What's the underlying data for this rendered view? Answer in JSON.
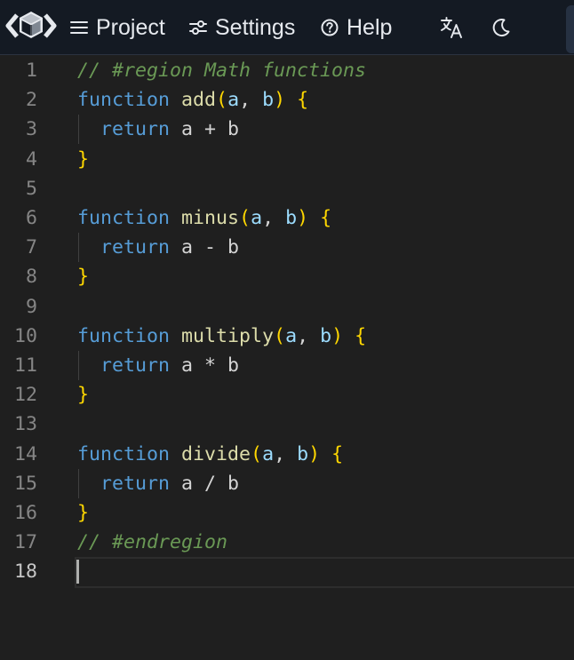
{
  "nav": {
    "project_label": "Project",
    "settings_label": "Settings",
    "help_label": "Help"
  },
  "icons": {
    "logo": "cube-logo-icon",
    "project": "hamburger-menu-icon",
    "settings": "sliders-icon",
    "help": "question-circle-icon",
    "translate": "translate-icon",
    "theme": "moon-icon"
  },
  "colors": {
    "topbar_bg": "#141a23",
    "editor_bg": "#1f1f1f",
    "keyword": "#569cd6",
    "function_name": "#dcdcaa",
    "param": "#9cdcfe",
    "brace": "#ffd700",
    "comment": "#6a9955"
  },
  "editor": {
    "current_line": 18,
    "lines": [
      {
        "num": "1",
        "tokens": [
          {
            "t": "// #region Math functions",
            "c": "comment"
          }
        ]
      },
      {
        "num": "2",
        "tokens": [
          {
            "t": "function",
            "c": "keyword"
          },
          {
            "t": " ",
            "c": "plain"
          },
          {
            "t": "add",
            "c": "func"
          },
          {
            "t": "(",
            "c": "brace"
          },
          {
            "t": "a",
            "c": "param"
          },
          {
            "t": ", ",
            "c": "plain"
          },
          {
            "t": "b",
            "c": "param"
          },
          {
            "t": ")",
            "c": "brace"
          },
          {
            "t": " ",
            "c": "plain"
          },
          {
            "t": "{",
            "c": "brace"
          }
        ]
      },
      {
        "num": "3",
        "tokens": [
          {
            "t": "  ",
            "c": "plain"
          },
          {
            "t": "return",
            "c": "keyword"
          },
          {
            "t": " a + b",
            "c": "plain"
          }
        ],
        "guide": true
      },
      {
        "num": "4",
        "tokens": [
          {
            "t": "}",
            "c": "brace"
          }
        ]
      },
      {
        "num": "5",
        "tokens": []
      },
      {
        "num": "6",
        "tokens": [
          {
            "t": "function",
            "c": "keyword"
          },
          {
            "t": " ",
            "c": "plain"
          },
          {
            "t": "minus",
            "c": "func"
          },
          {
            "t": "(",
            "c": "brace"
          },
          {
            "t": "a",
            "c": "param"
          },
          {
            "t": ", ",
            "c": "plain"
          },
          {
            "t": "b",
            "c": "param"
          },
          {
            "t": ")",
            "c": "brace"
          },
          {
            "t": " ",
            "c": "plain"
          },
          {
            "t": "{",
            "c": "brace"
          }
        ]
      },
      {
        "num": "7",
        "tokens": [
          {
            "t": "  ",
            "c": "plain"
          },
          {
            "t": "return",
            "c": "keyword"
          },
          {
            "t": " a - b",
            "c": "plain"
          }
        ],
        "guide": true
      },
      {
        "num": "8",
        "tokens": [
          {
            "t": "}",
            "c": "brace"
          }
        ]
      },
      {
        "num": "9",
        "tokens": []
      },
      {
        "num": "10",
        "tokens": [
          {
            "t": "function",
            "c": "keyword"
          },
          {
            "t": " ",
            "c": "plain"
          },
          {
            "t": "multiply",
            "c": "func"
          },
          {
            "t": "(",
            "c": "brace"
          },
          {
            "t": "a",
            "c": "param"
          },
          {
            "t": ", ",
            "c": "plain"
          },
          {
            "t": "b",
            "c": "param"
          },
          {
            "t": ")",
            "c": "brace"
          },
          {
            "t": " ",
            "c": "plain"
          },
          {
            "t": "{",
            "c": "brace"
          }
        ]
      },
      {
        "num": "11",
        "tokens": [
          {
            "t": "  ",
            "c": "plain"
          },
          {
            "t": "return",
            "c": "keyword"
          },
          {
            "t": " a * b",
            "c": "plain"
          }
        ],
        "guide": true
      },
      {
        "num": "12",
        "tokens": [
          {
            "t": "}",
            "c": "brace"
          }
        ]
      },
      {
        "num": "13",
        "tokens": []
      },
      {
        "num": "14",
        "tokens": [
          {
            "t": "function",
            "c": "keyword"
          },
          {
            "t": " ",
            "c": "plain"
          },
          {
            "t": "divide",
            "c": "func"
          },
          {
            "t": "(",
            "c": "brace"
          },
          {
            "t": "a",
            "c": "param"
          },
          {
            "t": ", ",
            "c": "plain"
          },
          {
            "t": "b",
            "c": "param"
          },
          {
            "t": ")",
            "c": "brace"
          },
          {
            "t": " ",
            "c": "plain"
          },
          {
            "t": "{",
            "c": "brace"
          }
        ]
      },
      {
        "num": "15",
        "tokens": [
          {
            "t": "  ",
            "c": "plain"
          },
          {
            "t": "return",
            "c": "keyword"
          },
          {
            "t": " a / b",
            "c": "plain"
          }
        ],
        "guide": true
      },
      {
        "num": "16",
        "tokens": [
          {
            "t": "}",
            "c": "brace"
          }
        ]
      },
      {
        "num": "17",
        "tokens": [
          {
            "t": "// #endregion",
            "c": "comment"
          }
        ]
      },
      {
        "num": "18",
        "tokens": []
      }
    ]
  }
}
